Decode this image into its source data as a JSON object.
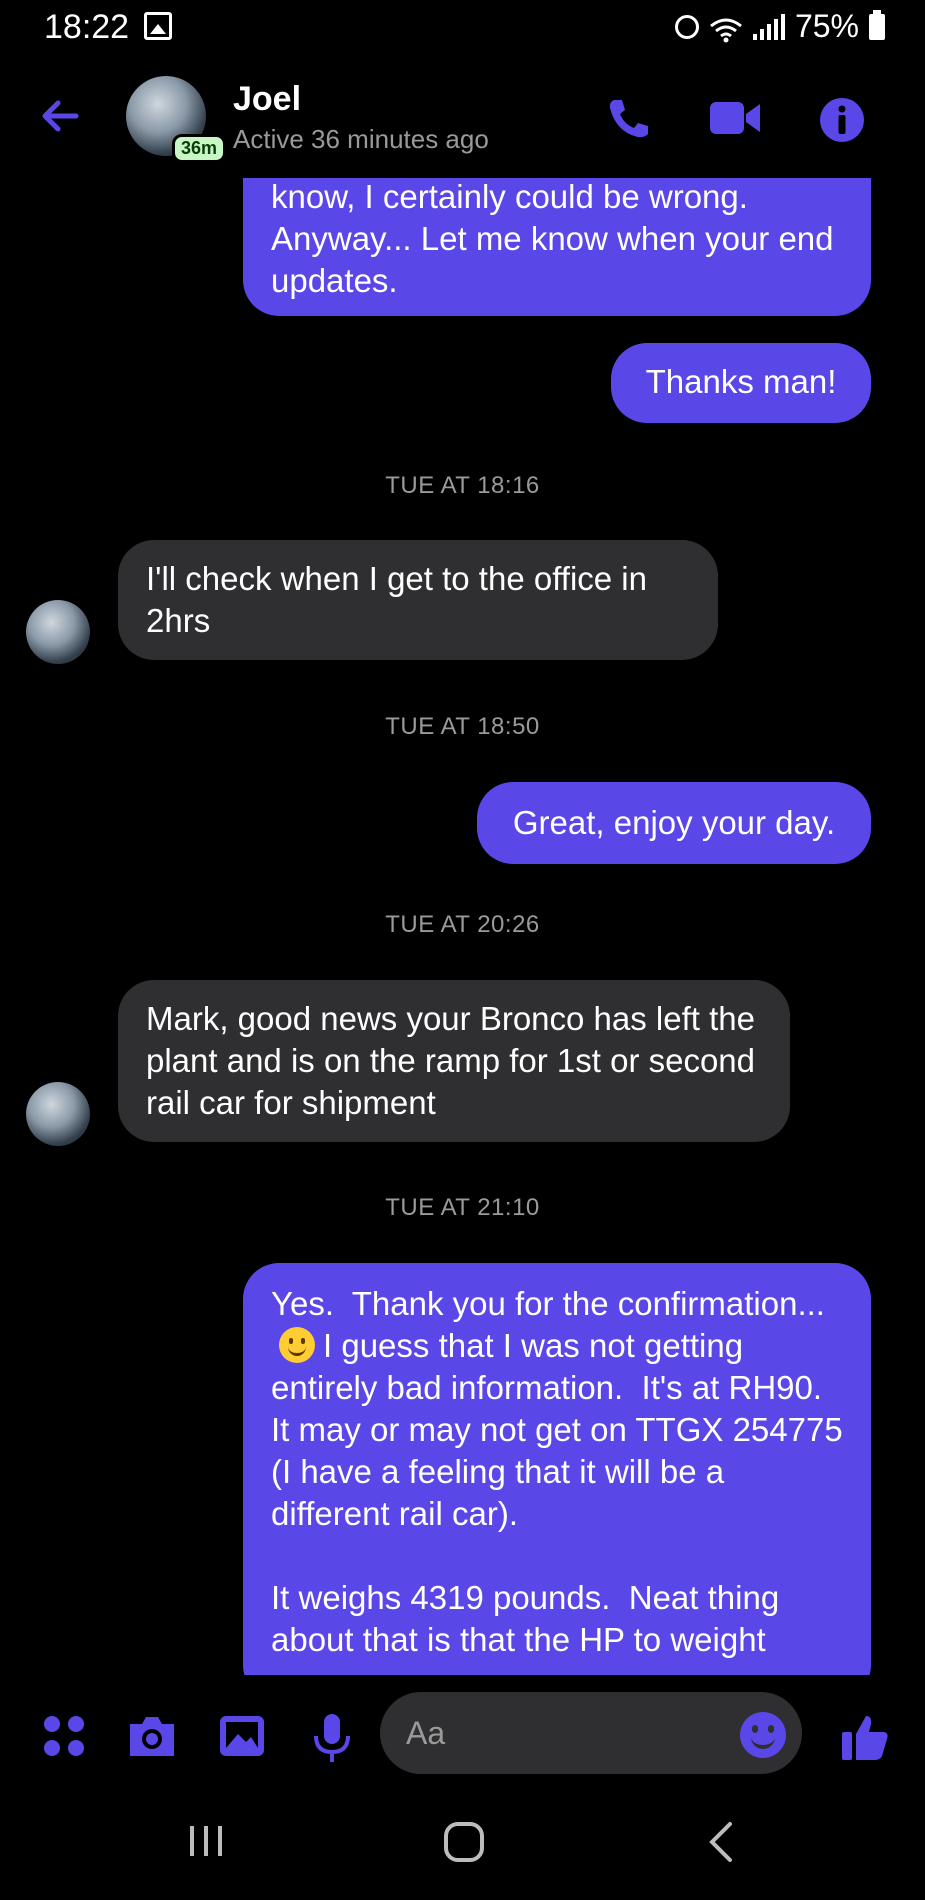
{
  "status_bar": {
    "time": "18:22",
    "battery": "75%"
  },
  "header": {
    "contact_name": "Joel",
    "presence": "Active 36 minutes ago",
    "avatar_badge": "36m",
    "accent_color": "#5a47e8"
  },
  "messages": [
    {
      "type": "sent",
      "text": "Corpus Christi... Then again, what do I know, I certainly could be wrong.  Anyway... Let me know when your end updates."
    },
    {
      "type": "sent",
      "text": "Thanks man!"
    },
    {
      "type": "timestamp",
      "text": "TUE AT 18:16"
    },
    {
      "type": "received",
      "text": "I'll check when I get to the office in 2hrs"
    },
    {
      "type": "timestamp",
      "text": "TUE AT 18:50"
    },
    {
      "type": "sent",
      "text": "Great, enjoy your day."
    },
    {
      "type": "timestamp",
      "text": "TUE AT 20:26"
    },
    {
      "type": "received",
      "text": "Mark, good news your Bronco has left the plant and is on the ramp for 1st or second rail car for shipment"
    },
    {
      "type": "timestamp",
      "text": "TUE AT 21:10"
    },
    {
      "type": "sent",
      "text_before_emoji": "Yes.  Thank you for the confirmation...",
      "emoji": "slightly-smiling-face",
      "text_after_emoji": "I guess that I was not getting entirely bad information.  It's at RH90.  It may or may not get on TTGX 254775 (I have a feeling that it will be a different rail car).\n\nIt weighs 4319 pounds.  Neat thing about that is that the HP to weight"
    }
  ],
  "composer": {
    "placeholder": "Aa",
    "icons": [
      "apps-icon",
      "camera-icon",
      "gallery-icon",
      "microphone-icon",
      "emoji-icon",
      "thumbs-up-icon"
    ]
  },
  "nav_bar": {
    "icons": [
      "recent-apps-icon",
      "home-icon",
      "back-icon"
    ]
  }
}
